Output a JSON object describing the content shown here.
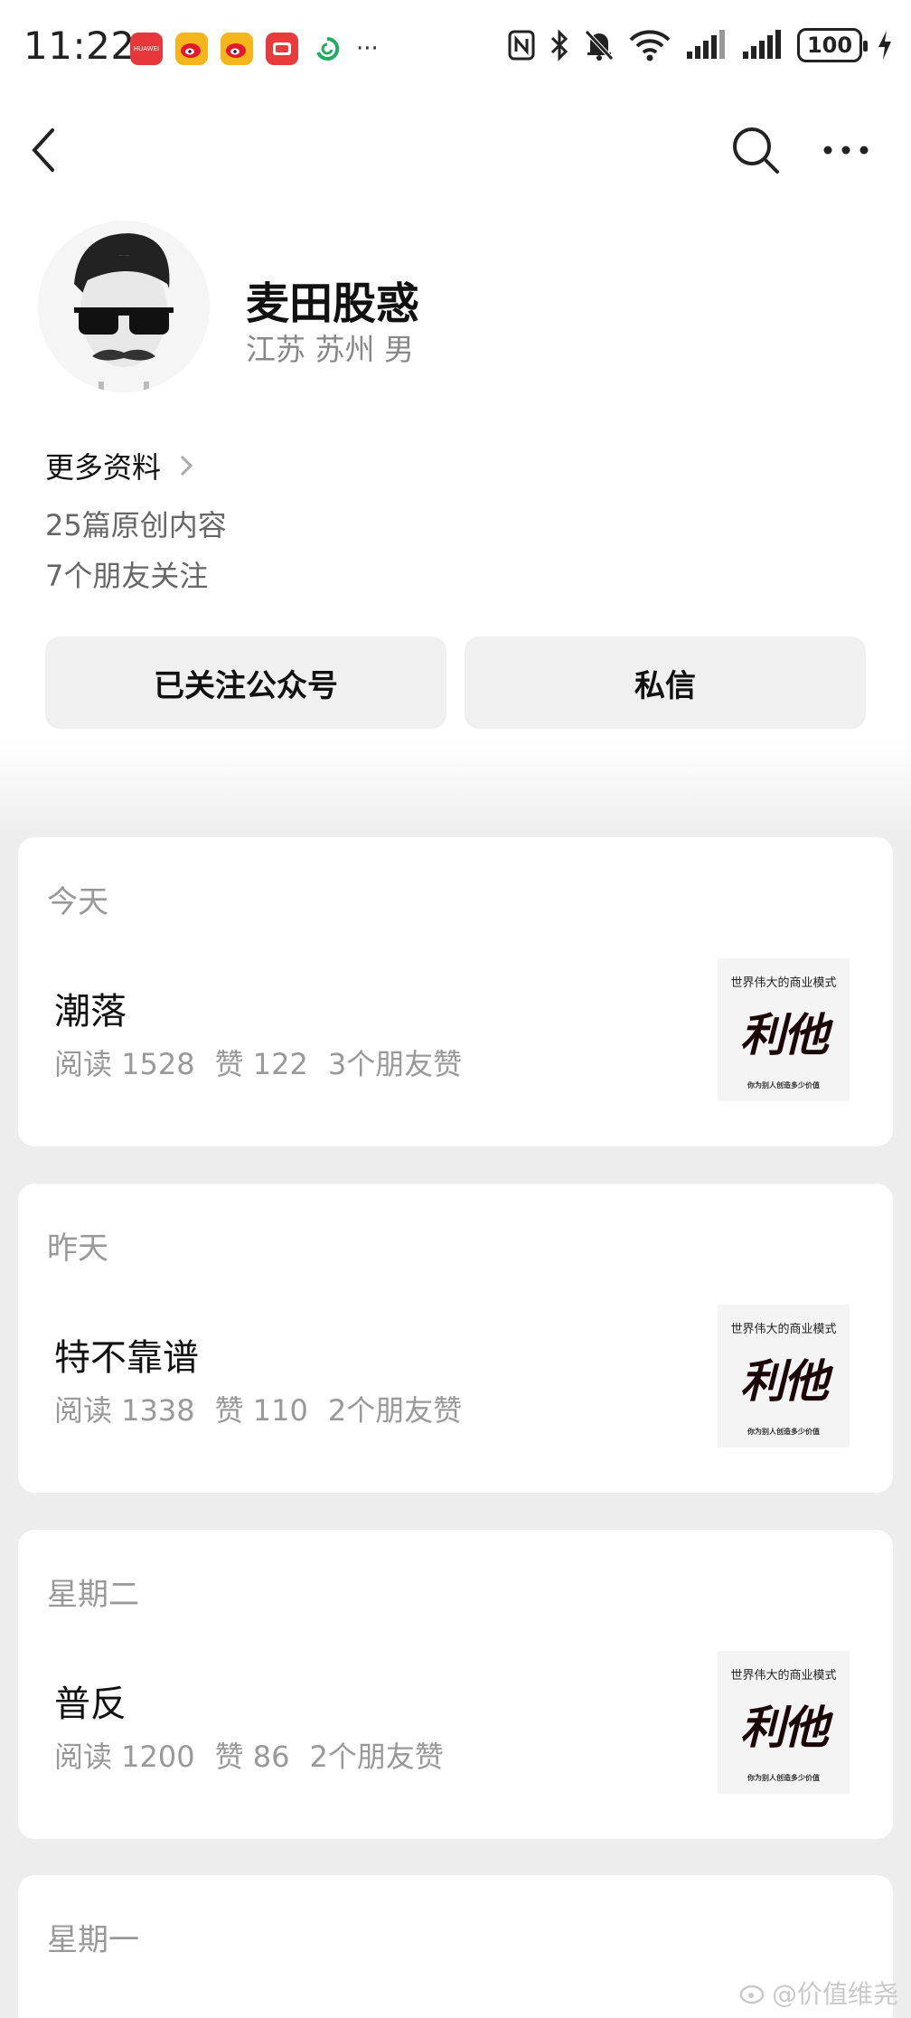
{
  "status_bar": {
    "time": "11:22",
    "notification_icons": [
      "huawei-store-icon",
      "weibo-icon",
      "weibo-icon",
      "red-app-icon",
      "green-app-icon"
    ],
    "store_badge_text": "HUAWEI",
    "more": "···",
    "battery": "100"
  },
  "nav": {
    "back_icon": "chevron-left-icon",
    "search_icon": "search-icon",
    "more_icon": "more-dots-icon"
  },
  "profile": {
    "name": "麦田股惑",
    "location": "江苏 苏州 男",
    "more_info": "更多资料",
    "article_count": "25篇原创内容",
    "friends_follow": "7个朋友关注"
  },
  "buttons": {
    "follow": "已关注公众号",
    "message": "私信"
  },
  "articles": [
    {
      "date": "今天",
      "title": "潮落",
      "reads": "阅读 1528",
      "likes": "赞 122",
      "friend_likes": "3个朋友赞",
      "thumb_top": "世界伟大的商业模式",
      "thumb_main": "利他",
      "thumb_bottom": "你为别人创造多少价值"
    },
    {
      "date": "昨天",
      "title": "特不靠谱",
      "reads": "阅读 1338",
      "likes": "赞 110",
      "friend_likes": "2个朋友赞",
      "thumb_top": "世界伟大的商业模式",
      "thumb_main": "利他",
      "thumb_bottom": "你为别人创造多少价值"
    },
    {
      "date": "星期二",
      "title": "普反",
      "reads": "阅读 1200",
      "likes": "赞 86",
      "friend_likes": "2个朋友赞",
      "thumb_top": "世界伟大的商业模式",
      "thumb_main": "利他",
      "thumb_bottom": "你为别人创造多少价值"
    },
    {
      "date": "星期一"
    }
  ],
  "watermark": "@价值维尧",
  "colors": {
    "background": "#ededed",
    "card": "#ffffff",
    "button": "#f0f0f0",
    "muted_text": "#999999"
  }
}
